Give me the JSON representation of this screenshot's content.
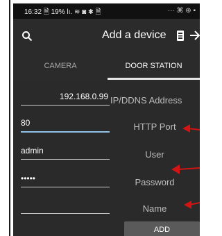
{
  "status_bar": {
    "left": "16:32 🗎 19% lı. ≋ ◙ ✱ 🗎",
    "right": "··· ⌘ ⊛ ▪"
  },
  "header": {
    "title": "Add a device",
    "search_icon": "search-icon",
    "qr_icon": "qr-icon",
    "forward_icon": "arrow-right-icon"
  },
  "tabs": [
    {
      "label": "CAMERA",
      "active": false
    },
    {
      "label": "DOOR STATION",
      "active": true
    }
  ],
  "form": {
    "ip": {
      "value": "192.168.0.99",
      "label": "IP/DDNS Address"
    },
    "port": {
      "value": "80",
      "label": "HTTP Port"
    },
    "user": {
      "value": "admin",
      "label": "User"
    },
    "password": {
      "value": "•••••",
      "label": "Password"
    },
    "name": {
      "value": "",
      "label": "Name"
    }
  },
  "add_button": {
    "label": "ADD"
  },
  "colors": {
    "background": "#2a2a2a",
    "accent_focus": "#8fc3e8",
    "annotation_red": "#d11414"
  }
}
